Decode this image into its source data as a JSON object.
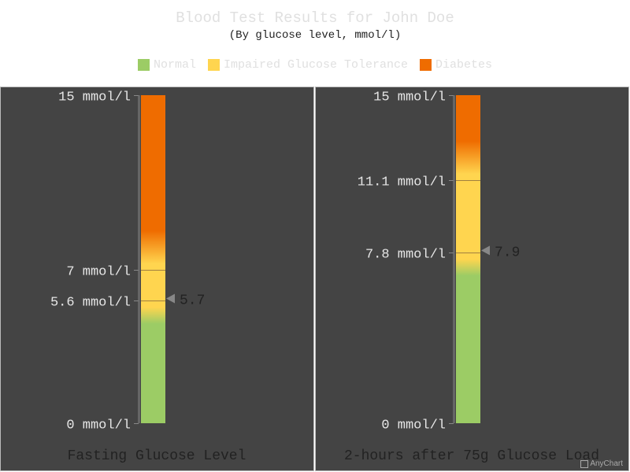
{
  "header": {
    "title": "Blood Test Results for John Doe",
    "subtitle": "(By glucose level, mmol/l)"
  },
  "legend": [
    {
      "label": "Normal",
      "color": "#9ccc65"
    },
    {
      "label": "Impaired Glucose Tolerance",
      "color": "#ffd54f"
    },
    {
      "label": "Diabetes",
      "color": "#ef6c00"
    }
  ],
  "chart_data": [
    {
      "type": "linear-gauge",
      "title": "Fasting Glucose Level",
      "scale": [
        0,
        15
      ],
      "ticks": [
        {
          "value": 0,
          "label": "0 mmol/l"
        },
        {
          "value": 5.6,
          "label": "5.6 mmol/l"
        },
        {
          "value": 7,
          "label": "7 mmol/l"
        },
        {
          "value": 15,
          "label": "15 mmol/l"
        }
      ],
      "ranges": [
        {
          "name": "Normal",
          "from": 0,
          "to": 5.6
        },
        {
          "name": "Impaired Glucose Tolerance",
          "from": 5.6,
          "to": 7
        },
        {
          "name": "Diabetes",
          "from": 7,
          "to": 15
        }
      ],
      "value": 5.7,
      "value_label": "5.7"
    },
    {
      "type": "linear-gauge",
      "title": "2-hours after 75g Glucose Load",
      "scale": [
        0,
        15
      ],
      "ticks": [
        {
          "value": 0,
          "label": "0 mmol/l"
        },
        {
          "value": 7.8,
          "label": "7.8 mmol/l"
        },
        {
          "value": 11.1,
          "label": "11.1 mmol/l"
        },
        {
          "value": 15,
          "label": "15 mmol/l"
        }
      ],
      "ranges": [
        {
          "name": "Normal",
          "from": 0,
          "to": 7.8
        },
        {
          "name": "Impaired Glucose Tolerance",
          "from": 7.8,
          "to": 11.1
        },
        {
          "name": "Diabetes",
          "from": 11.1,
          "to": 15
        }
      ],
      "value": 7.9,
      "value_label": "7.9"
    }
  ],
  "credits": "AnyChart"
}
